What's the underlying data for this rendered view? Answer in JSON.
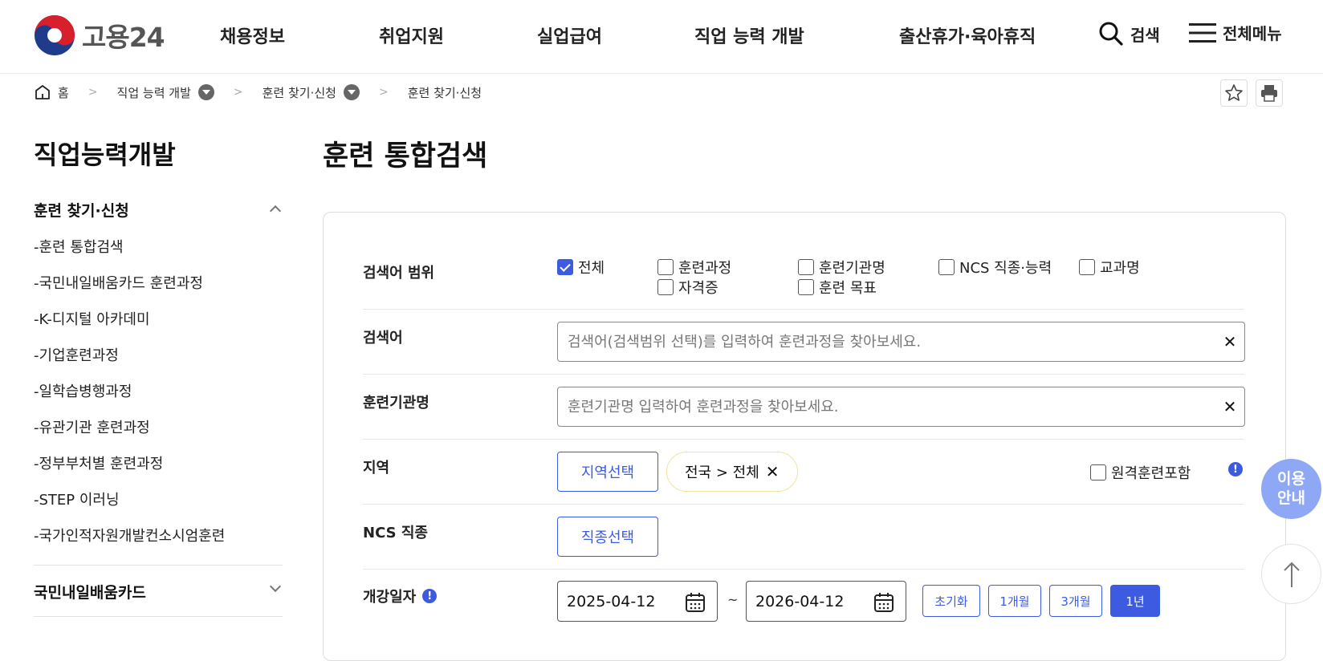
{
  "header": {
    "logo_text": "고용24",
    "nav": [
      "채용정보",
      "취업지원",
      "실업급여",
      "직업 능력 개발",
      "출산휴가·육아휴직"
    ],
    "search_label": "검색",
    "menu_label": "전체메뉴"
  },
  "breadcrumb": {
    "home": "홈",
    "level1": "직업 능력 개발",
    "level2": "훈련 찾기·신청",
    "current": "훈련 찾기·신청"
  },
  "sidebar": {
    "title": "직업능력개발",
    "group1": "훈련 찾기·신청",
    "items": [
      "-훈련 통합검색",
      "-국민내일배움카드 훈련과정",
      "-K-디지털 아카데미",
      "-기업훈련과정",
      "-일학습병행과정",
      "-유관기관 훈련과정",
      "-정부부처별 훈련과정",
      "-STEP 이러닝",
      "-국가인적자원개발컨소시엄훈련"
    ],
    "group2": "국민내일배움카드"
  },
  "main": {
    "title": "훈련 통합검색",
    "scope": {
      "label": "검색어 범위",
      "options": [
        {
          "label": "전체",
          "checked": true
        },
        {
          "label": "훈련과정",
          "checked": false
        },
        {
          "label": "훈련기관명",
          "checked": false
        },
        {
          "label": "NCS 직종·능력",
          "checked": false
        },
        {
          "label": "교과명",
          "checked": false
        },
        {
          "label": "자격증",
          "checked": false
        },
        {
          "label": "훈련 목표",
          "checked": false
        }
      ]
    },
    "keyword": {
      "label": "검색어",
      "placeholder": "검색어(검색범위 선택)를 입력하여 훈련과정을 찾아보세요.",
      "value": ""
    },
    "institution": {
      "label": "훈련기관명",
      "placeholder": "훈련기관명 입력하여 훈련과정을 찾아보세요.",
      "value": ""
    },
    "region": {
      "label": "지역",
      "button": "지역선택",
      "chip": "전국 > 전체",
      "remote_label": "원격훈련포함"
    },
    "ncs": {
      "label": "NCS 직종",
      "button": "직종선택"
    },
    "start_date": {
      "label": "개강일자",
      "from": "2025-04-12",
      "tilde": "~",
      "to": "2026-04-12",
      "periods": [
        "초기화",
        "1개월",
        "3개월",
        "1년"
      ],
      "active_period": "1년"
    }
  },
  "floating": {
    "guide_line1": "이용",
    "guide_line2": "안내"
  },
  "colors": {
    "accent": "#3d5be0",
    "chip_border": "#f0e39c",
    "float_guide": "#8fa8f5"
  }
}
